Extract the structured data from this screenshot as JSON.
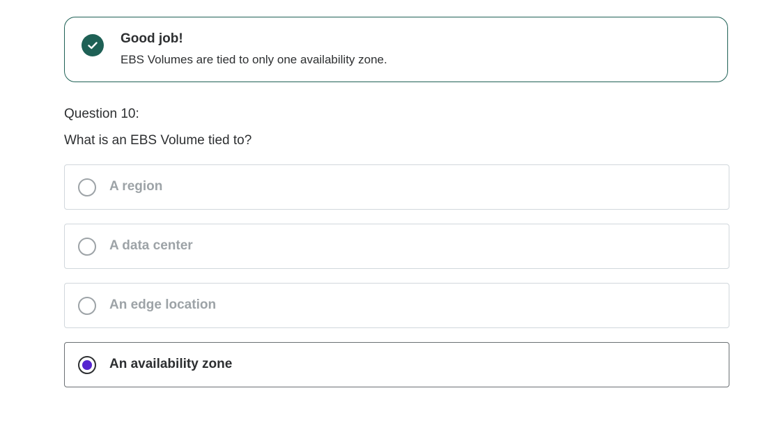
{
  "feedback": {
    "title": "Good job!",
    "message": "EBS Volumes are tied to only one availability zone.",
    "icon": "check-circle-icon",
    "color": "#1e6055"
  },
  "question": {
    "number_label": "Question 10:",
    "text": "What is an EBS Volume tied to?"
  },
  "options": [
    {
      "label": "A region",
      "selected": false
    },
    {
      "label": "A data center",
      "selected": false
    },
    {
      "label": "An edge location",
      "selected": false
    },
    {
      "label": "An availability zone",
      "selected": true
    }
  ],
  "colors": {
    "accent": "#5624d0",
    "success": "#1e6055",
    "text": "#2d2f31",
    "muted": "#9da3a7"
  }
}
